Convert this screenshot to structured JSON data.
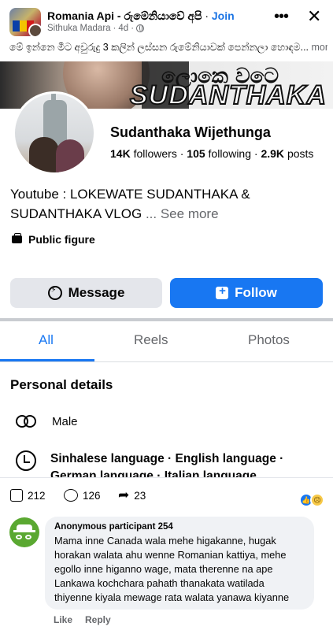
{
  "header": {
    "group_name": "Romania Api - රුමේනියාවේ අපි",
    "join_label": "Join",
    "author": "Sithuka Madara",
    "time": "4d",
    "thumb_text": "Romania"
  },
  "caption": {
    "text": "මේ ඉන්නෙ මීට අවුරුදු 3 කලින් ලස්සන රුමේනියාවක් පෙන්නලා හොඳම...",
    "more_label": "more"
  },
  "cover": {
    "sinhala_text": "ලොකෙ වටෙ",
    "name_text": "SUDANTHAKA"
  },
  "profile": {
    "name": "Sudanthaka Wijethunga",
    "followers_count": "14K",
    "followers_label": "followers",
    "following_count": "105",
    "following_label": "following",
    "posts_count": "2.9K",
    "posts_label": "posts",
    "bio_line1": "Youtube : LOKEWATE SUDANTHAKA &",
    "bio_line2": "SUDANTHAKA VLOG",
    "bio_ellipsis": " ... ",
    "see_more": "See more",
    "category": "Public figure"
  },
  "buttons": {
    "message": "Message",
    "follow": "Follow"
  },
  "tabs": [
    {
      "label": "All",
      "active": true
    },
    {
      "label": "Reels",
      "active": false
    },
    {
      "label": "Photos",
      "active": false
    }
  ],
  "personal_details": {
    "title": "Personal details",
    "gender": "Male",
    "languages_line1": "Sinhalese language · English language ·",
    "languages_line2": "German language · Italian language"
  },
  "reactions": {
    "likes": "212",
    "comments": "126",
    "shares": "23"
  },
  "comment": {
    "author": "Anonymous participant 254",
    "text": "Mama inne Canada wala mehe higakanne, hugak horakan walata ahu wenne Romanian kattiya, mehe egollo inne higanno wage, mata therenne na ape Lankawa kochchara pahath thanakata watilada thiyenne kiyala mewage rata walata yanawa kiyanne",
    "like_label": "Like",
    "reply_label": "Reply"
  },
  "colors": {
    "accent": "#1877f2",
    "join": "#1b74e4",
    "muted": "#65676b",
    "button_grey": "#e4e6eb",
    "comment_bg": "#f0f2f5",
    "avatar_green": "#5aa831"
  },
  "icons": [
    "globe-icon",
    "more-icon",
    "close-icon",
    "briefcase-icon",
    "messenger-icon",
    "follow-icon",
    "gender-icon",
    "language-icon",
    "like-icon",
    "comment-icon",
    "share-icon",
    "like-reaction-icon",
    "sad-reaction-icon",
    "anonymous-avatar-icon"
  ]
}
